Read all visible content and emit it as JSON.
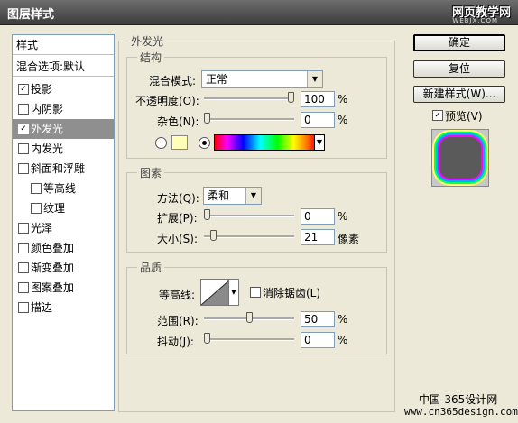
{
  "window": {
    "title": "图层样式",
    "watermark": "网页教学网",
    "watermark_sub": "WEBJX.COM"
  },
  "left_panel": {
    "header": "样式",
    "blend_options": "混合选项:默认",
    "items": [
      {
        "label": "投影",
        "checked": "✓",
        "indent": false,
        "selected": false
      },
      {
        "label": "内阴影",
        "checked": "",
        "indent": false,
        "selected": false
      },
      {
        "label": "外发光",
        "checked": "✓",
        "indent": false,
        "selected": true
      },
      {
        "label": "内发光",
        "checked": "",
        "indent": false,
        "selected": false
      },
      {
        "label": "斜面和浮雕",
        "checked": "",
        "indent": false,
        "selected": false
      },
      {
        "label": "等高线",
        "checked": "",
        "indent": true,
        "selected": false
      },
      {
        "label": "纹理",
        "checked": "",
        "indent": true,
        "selected": false
      },
      {
        "label": "光泽",
        "checked": "",
        "indent": false,
        "selected": false
      },
      {
        "label": "颜色叠加",
        "checked": "",
        "indent": false,
        "selected": false
      },
      {
        "label": "渐变叠加",
        "checked": "",
        "indent": false,
        "selected": false
      },
      {
        "label": "图案叠加",
        "checked": "",
        "indent": false,
        "selected": false
      },
      {
        "label": "描边",
        "checked": "",
        "indent": false,
        "selected": false
      }
    ]
  },
  "outer_glow": {
    "title": "外发光",
    "structure": {
      "title": "结构",
      "blend_mode_label": "混合模式:",
      "blend_mode_value": "正常",
      "opacity_label": "不透明度(O):",
      "opacity_value": "100",
      "opacity_level": 1.0,
      "noise_label": "杂色(N):",
      "noise_value": "0",
      "noise_level": 0.0,
      "percent": "%",
      "swatch_color": "#ffffb8"
    },
    "elements": {
      "title": "图素",
      "technique_label": "方法(Q):",
      "technique_value": "柔和",
      "spread_label": "扩展(P):",
      "spread_value": "0",
      "spread_level": 0.0,
      "size_label": "大小(S):",
      "size_value": "21",
      "size_unit": "像素",
      "size_level": 0.08,
      "percent": "%"
    },
    "quality": {
      "title": "品质",
      "contour_label": "等高线:",
      "antialias_label": "消除锯齿(L)",
      "range_label": "范围(R):",
      "range_value": "50",
      "range_level": 0.5,
      "jitter_label": "抖动(J):",
      "jitter_value": "0",
      "jitter_level": 0.0,
      "percent": "%"
    }
  },
  "buttons": {
    "ok": "确定",
    "reset": "复位",
    "new_style": "新建样式(W)...",
    "preview_label": "预览(V)",
    "preview_checked": "✓"
  },
  "footer": {
    "line1": "中国-365设计网",
    "line2": "www.cn365design.com"
  }
}
